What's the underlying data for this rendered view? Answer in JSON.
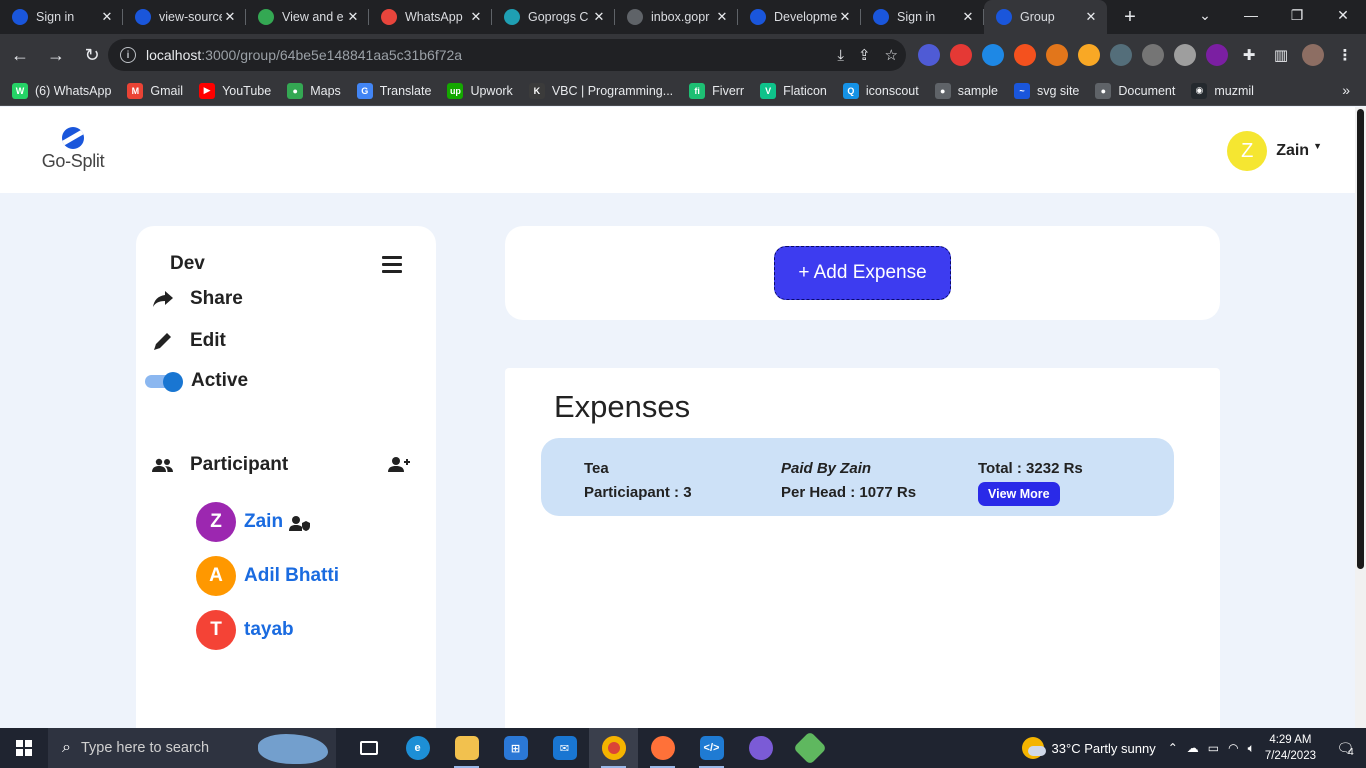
{
  "browser": {
    "tabs": [
      {
        "label": "Sign in",
        "color": "#1a56db",
        "active": false
      },
      {
        "label": "view-source",
        "color": "#1a56db",
        "active": false
      },
      {
        "label": "View and e",
        "color": "#34a853",
        "active": false
      },
      {
        "label": "WhatsApp",
        "color": "#e8453c",
        "active": false
      },
      {
        "label": "Goprogs C",
        "color": "#1f9fb3",
        "active": false
      },
      {
        "label": "inbox.gopr",
        "color": "#5f6368",
        "active": false
      },
      {
        "label": "Developme",
        "color": "#1a56db",
        "active": false
      },
      {
        "label": "Sign in",
        "color": "#1a56db",
        "active": false
      },
      {
        "label": "Group",
        "color": "#1a56db",
        "active": true
      }
    ],
    "url_host": "localhost",
    "url_path": ":3000/group/64be5e148841aa5c31b6f72a",
    "bookmarks": [
      {
        "label": "(6) WhatsApp",
        "color": "#25d366",
        "glyph": "W"
      },
      {
        "label": "Gmail",
        "color": "#ea4335",
        "glyph": "M"
      },
      {
        "label": "YouTube",
        "color": "#ff0000",
        "glyph": "▶"
      },
      {
        "label": "Maps",
        "color": "#34a853",
        "glyph": "●"
      },
      {
        "label": "Translate",
        "color": "#4285f4",
        "glyph": "G"
      },
      {
        "label": "Upwork",
        "color": "#14a800",
        "glyph": "up"
      },
      {
        "label": "VBC | Programming...",
        "color": "#3b3b3b",
        "glyph": "K"
      },
      {
        "label": "Fiverr",
        "color": "#1dbf73",
        "glyph": "fi"
      },
      {
        "label": "Flaticon",
        "color": "#0ec28a",
        "glyph": "V"
      },
      {
        "label": "iconscout",
        "color": "#1592e6",
        "glyph": "Q"
      },
      {
        "label": "sample",
        "color": "#5f6368",
        "glyph": "●"
      },
      {
        "label": "svg site",
        "color": "#1a56db",
        "glyph": "~"
      },
      {
        "label": "Document",
        "color": "#5f6368",
        "glyph": "●"
      },
      {
        "label": "muzmil",
        "color": "#24292e",
        "glyph": "◉"
      }
    ]
  },
  "app": {
    "logo_text": "Go-Split",
    "user": {
      "initial": "Z",
      "name": "Zain"
    },
    "group": {
      "name": "Dev"
    },
    "actions": {
      "share": "Share",
      "edit": "Edit",
      "active": "Active"
    },
    "participants_label": "Participant",
    "members": [
      {
        "initial": "Z",
        "name": "Zain",
        "color": "#9c27b0",
        "admin": true
      },
      {
        "initial": "A",
        "name": "Adil Bhatti",
        "color": "#ff9800",
        "admin": false
      },
      {
        "initial": "T",
        "name": "tayab",
        "color": "#f44336",
        "admin": false
      }
    ],
    "add_expense_label": "+ Add Expense",
    "expenses_title": "Expenses",
    "expense": {
      "name": "Tea",
      "participants": "Particiapant : 3",
      "paid_by": "Paid By Zain",
      "per_head": "Per Head : 1077 Rs",
      "total": "Total : 3232 Rs",
      "view_more": "View More"
    },
    "accent_color": "#3d3cf0"
  },
  "taskbar": {
    "search_placeholder": "Type here to search",
    "weather": "33°C  Partly sunny",
    "time": "4:29 AM",
    "date": "7/24/2023",
    "notifications": "4"
  }
}
